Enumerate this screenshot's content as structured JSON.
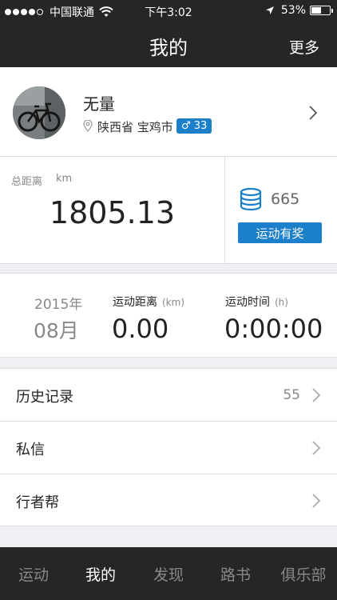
{
  "status_bar": {
    "carrier": "中国联通",
    "time": "下午3:02",
    "battery": "53%",
    "battery_level": 0.53,
    "signal_bars": 4
  },
  "nav": {
    "title": "我的",
    "more": "更多"
  },
  "profile": {
    "name": "无量",
    "location": "陕西省 宝鸡市",
    "gender_age": "♂ 33"
  },
  "stats": {
    "total_distance_label": "总距离",
    "unit": "km",
    "total_distance": "1805.13",
    "points": "665",
    "reward_button": "运动有奖"
  },
  "monthly": {
    "year": "2015年",
    "month": "08月",
    "distance_label": "运动距离",
    "distance_unit": "(km)",
    "distance": "0.00",
    "time_label": "运动时间",
    "time_unit": "(h)",
    "time": "0:00:00"
  },
  "menu": [
    {
      "label": "历史记录",
      "count": "55"
    },
    {
      "label": "私信"
    },
    {
      "label": "行者帮"
    }
  ],
  "tabs": [
    {
      "label": "运动"
    },
    {
      "label": "我的"
    },
    {
      "label": "发现"
    },
    {
      "label": "路书"
    },
    {
      "label": "俱乐部"
    }
  ],
  "colors": {
    "bar_background": "#262626",
    "accent_blue": "#1b7fc9",
    "page_background": "#efeff4"
  }
}
